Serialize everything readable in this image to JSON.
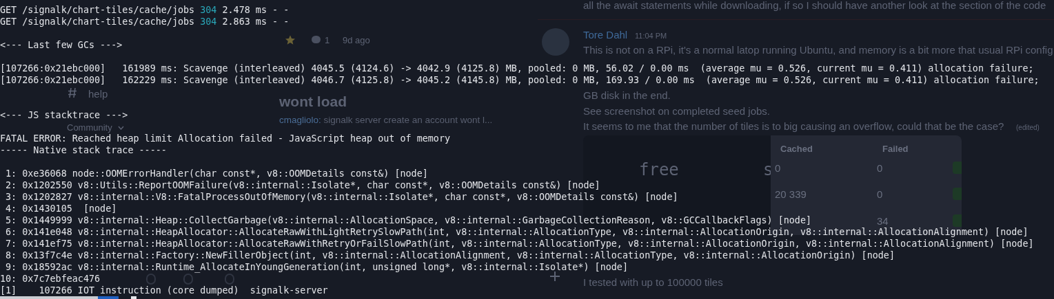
{
  "background": {
    "channels": [
      {
        "kind": "text",
        "label": "help"
      },
      {
        "kind": "category",
        "label": "Community"
      }
    ],
    "forum_posts": [
      {
        "comments": "1",
        "age": "9d ago"
      },
      {
        "title": "wont load",
        "author": "cmagliolo:",
        "preview": "signalk server create an account wont l..."
      }
    ],
    "chat": {
      "earlier_line": "all the await statements while downloading, if so I should have another look at the section of the code",
      "author": "Tore Dahl",
      "time": "11:04 PM",
      "lines": [
        "This is not on a RPi, it's a normal latop running Ubuntu, and memory is a bit more that usual RPi config",
        "GB disk in the end.",
        "See screenshot on completed seed jobs.",
        "It seems to me that the number of tiles is to big causing an overflow, could that be the case?"
      ],
      "edited": "(edited)",
      "attachment": {
        "left_text": [
          "free",
          "s"
        ],
        "columns": [
          "Cached",
          "Failed"
        ],
        "rows": [
          [
            "0",
            "0"
          ],
          [
            "20 339",
            "0"
          ],
          [
            "",
            "34"
          ]
        ]
      },
      "last_line": "I tested with up to 100000 tiles"
    }
  },
  "terminal": {
    "lines": [
      {
        "kind": "request",
        "method": "GET",
        "path": "/signalk/chart-tiles/cache/jobs",
        "status": "304",
        "rest": "2.478 ms - -"
      },
      {
        "kind": "request",
        "method": "GET",
        "path": "/signalk/chart-tiles/cache/jobs",
        "status": "304",
        "rest": "2.863 ms - -"
      },
      {
        "kind": "blank"
      },
      {
        "kind": "text",
        "text": "<--- Last few GCs --->"
      },
      {
        "kind": "blank"
      },
      {
        "kind": "text",
        "text": "[107266:0x21ebc000]   161989 ms: Scavenge (interleaved) 4045.5 (4124.6) -> 4042.9 (4125.8) MB, pooled: 0 MB, 56.02 / 0.00 ms  (average mu = 0.526, current mu = 0.411) allocation failure;"
      },
      {
        "kind": "text",
        "text": "[107266:0x21ebc000]   162229 ms: Scavenge (interleaved) 4046.7 (4125.8) -> 4045.2 (4145.8) MB, pooled: 0 MB, 169.93 / 0.00 ms  (average mu = 0.526, current mu = 0.411) allocation failure;"
      },
      {
        "kind": "blank"
      },
      {
        "kind": "blank"
      },
      {
        "kind": "text",
        "text": "<--- JS stacktrace --->"
      },
      {
        "kind": "blank"
      },
      {
        "kind": "text",
        "text": "FATAL ERROR: Reached heap limit Allocation failed - JavaScript heap out of memory"
      },
      {
        "kind": "text",
        "text": "----- Native stack trace -----"
      },
      {
        "kind": "blank"
      },
      {
        "kind": "text",
        "text": " 1: 0xe36068 node::OOMErrorHandler(char const*, v8::OOMDetails const&) [node]"
      },
      {
        "kind": "text",
        "text": " 2: 0x1202550 v8::Utils::ReportOOMFailure(v8::internal::Isolate*, char const*, v8::OOMDetails const&) [node]"
      },
      {
        "kind": "text",
        "text": " 3: 0x1202827 v8::internal::V8::FatalProcessOutOfMemory(v8::internal::Isolate*, char const*, v8::OOMDetails const&) [node]"
      },
      {
        "kind": "text",
        "text": " 4: 0x1430105  [node]"
      },
      {
        "kind": "text",
        "text": " 5: 0x1449999 v8::internal::Heap::CollectGarbage(v8::internal::AllocationSpace, v8::internal::GarbageCollectionReason, v8::GCCallbackFlags) [node]"
      },
      {
        "kind": "text",
        "text": " 6: 0x141e048 v8::internal::HeapAllocator::AllocateRawWithLightRetrySlowPath(int, v8::internal::AllocationType, v8::internal::AllocationOrigin, v8::internal::AllocationAlignment) [node]"
      },
      {
        "kind": "text",
        "text": " 7: 0x141ef75 v8::internal::HeapAllocator::AllocateRawWithRetryOrFailSlowPath(int, v8::internal::AllocationType, v8::internal::AllocationOrigin, v8::internal::AllocationAlignment) [node]"
      },
      {
        "kind": "text",
        "text": " 8: 0x13f7c4e v8::internal::Factory::NewFillerObject(int, v8::internal::AllocationAlignment, v8::internal::AllocationType, v8::internal::AllocationOrigin) [node]"
      },
      {
        "kind": "text",
        "text": " 9: 0x18592ac v8::internal::Runtime_AllocateInYoungGeneration(int, unsigned long*, v8::internal::Isolate*) [node]"
      },
      {
        "kind": "text",
        "text": "10: 0x7c7ebfeac476"
      },
      {
        "kind": "text",
        "text": "[1]    107266 IOT instruction (core dumped)  signalk-server"
      }
    ]
  }
}
